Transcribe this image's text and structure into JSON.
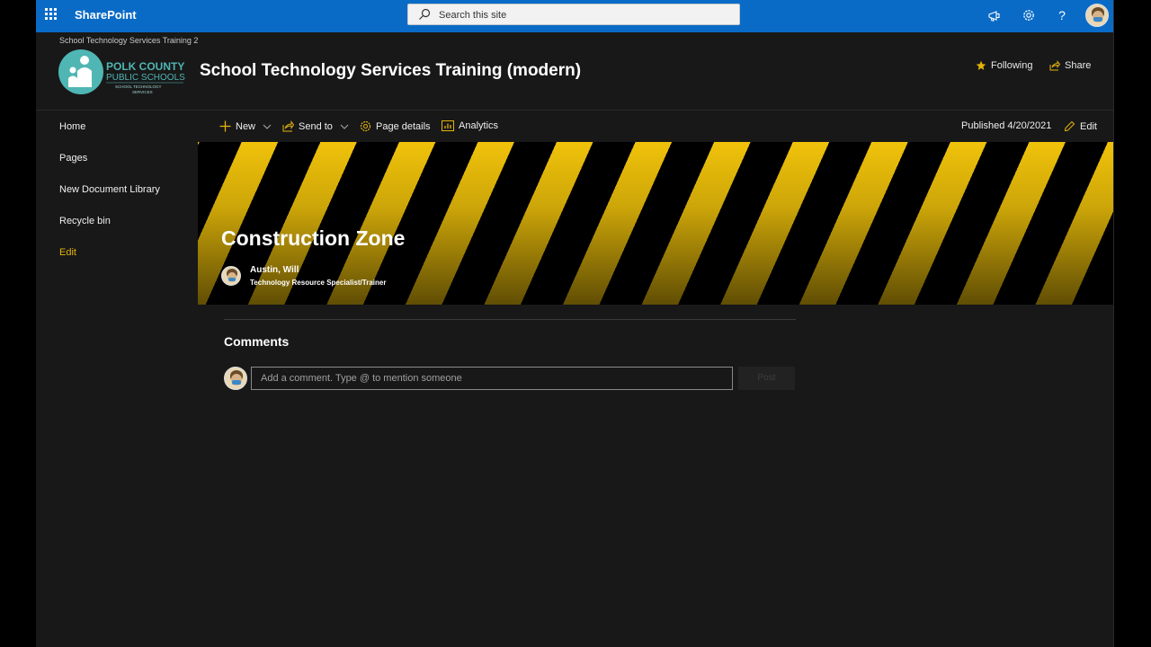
{
  "suitebar": {
    "brand": "SharePoint",
    "search_placeholder": "Search this site"
  },
  "header": {
    "breadcrumb": "School Technology Services Training 2",
    "logo": {
      "line1": "POLK COUNTY",
      "line2": "PUBLIC SCHOOLS",
      "line3": "SCHOOL TECHNOLOGY",
      "line4": "SERVICES"
    },
    "site_title": "School Technology Services Training (modern)",
    "following_label": "Following",
    "share_label": "Share"
  },
  "nav": {
    "items": [
      {
        "label": "Home"
      },
      {
        "label": "Pages"
      },
      {
        "label": "New Document Library"
      },
      {
        "label": "Recycle bin"
      },
      {
        "label": "Edit"
      }
    ]
  },
  "commandbar": {
    "new_label": "New",
    "send_label": "Send to",
    "details_label": "Page details",
    "analytics_label": "Analytics",
    "published": "Published 4/20/2021",
    "edit_label": "Edit"
  },
  "banner": {
    "title": "Construction Zone",
    "author_name": "Austin, Will",
    "author_role": "Technology Resource Specialist/Trainer"
  },
  "comments": {
    "title": "Comments",
    "placeholder": "Add a comment. Type @ to mention someone",
    "post_label": "Post"
  },
  "colors": {
    "suitebar": "#0a6bc7",
    "accent": "#e3b30e",
    "background": "#181818",
    "stripe": "#f0c20a"
  }
}
